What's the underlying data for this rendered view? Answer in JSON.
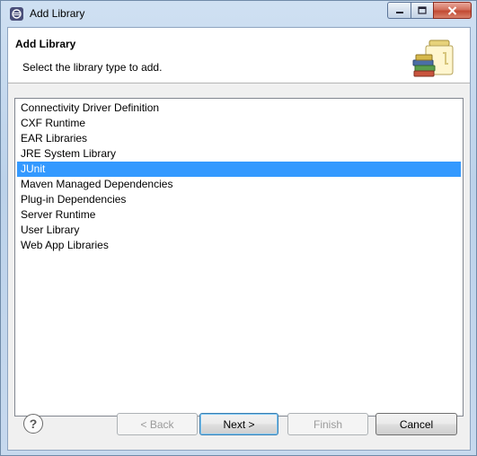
{
  "window": {
    "title": "Add Library"
  },
  "banner": {
    "title": "Add Library",
    "description": "Select the library type to add."
  },
  "library_types": {
    "selected": "JUnit",
    "items": [
      "Connectivity Driver Definition",
      "CXF Runtime",
      "EAR Libraries",
      "JRE System Library",
      "JUnit",
      "Maven Managed Dependencies",
      "Plug-in Dependencies",
      "Server Runtime",
      "User Library",
      "Web App Libraries"
    ]
  },
  "buttons": {
    "help_label": "?",
    "back_label": "< Back",
    "next_label": "Next >",
    "finish_label": "Finish",
    "cancel_label": "Cancel"
  },
  "icons": {
    "app": "eclipse-icon",
    "banner": "library-jar-icon",
    "help": "help-icon"
  },
  "colors": {
    "selection": "#3399ff",
    "close_button": "#c24a33"
  }
}
